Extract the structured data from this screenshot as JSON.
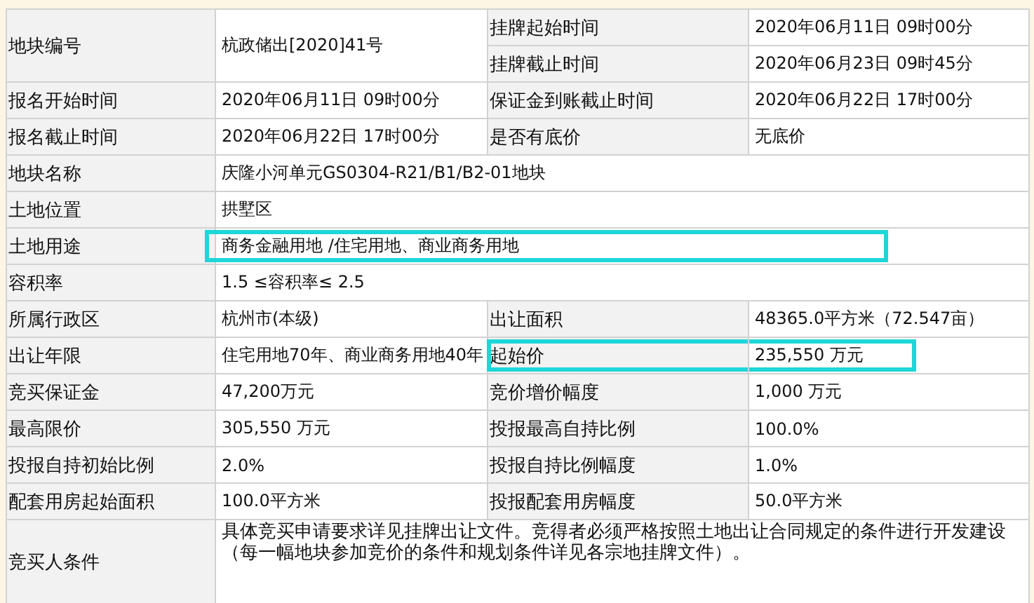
{
  "rows": [
    {
      "cells": [
        {
          "kind": "label",
          "text": "地块编号",
          "rowspan": 2
        },
        {
          "kind": "value",
          "text": "杭政储出[2020]41号",
          "rowspan": 2
        },
        {
          "kind": "label",
          "text": "挂牌起始时间"
        },
        {
          "kind": "value",
          "text": "2020年06月11日  09时00分"
        }
      ]
    },
    {
      "cells": [
        {
          "kind": "label",
          "text": "挂牌截止时间"
        },
        {
          "kind": "value",
          "text": "2020年06月23日  09时45分"
        }
      ]
    },
    {
      "cells": [
        {
          "kind": "label",
          "text": "报名开始时间"
        },
        {
          "kind": "value",
          "text": "2020年06月11日  09时00分"
        },
        {
          "kind": "label",
          "text": "保证金到账截止时间"
        },
        {
          "kind": "value",
          "text": "2020年06月22日  17时00分"
        }
      ]
    },
    {
      "cells": [
        {
          "kind": "label",
          "text": "报名截止时间"
        },
        {
          "kind": "value",
          "text": "2020年06月22日  17时00分"
        },
        {
          "kind": "label",
          "text": "是否有底价"
        },
        {
          "kind": "value",
          "text": "无底价"
        }
      ]
    },
    {
      "cells": [
        {
          "kind": "label",
          "text": "地块名称"
        },
        {
          "kind": "value",
          "text": "庆隆小河单元GS0304-R21/B1/B2-01地块",
          "colspan": 3
        }
      ]
    },
    {
      "cells": [
        {
          "kind": "label",
          "text": "土地位置"
        },
        {
          "kind": "value",
          "text": "拱墅区",
          "colspan": 3
        }
      ]
    },
    {
      "cells": [
        {
          "kind": "label",
          "text": "土地用途"
        },
        {
          "kind": "value",
          "text": "商务金融用地 /住宅用地、商业商务用地",
          "colspan": 3,
          "highlighted": true
        }
      ]
    },
    {
      "cells": [
        {
          "kind": "label",
          "text": "容积率"
        },
        {
          "kind": "value",
          "text": "1.5 ≤容积率≤ 2.5",
          "colspan": 3
        }
      ]
    },
    {
      "cells": [
        {
          "kind": "label",
          "text": "所属行政区"
        },
        {
          "kind": "value",
          "text": "杭州市(本级)"
        },
        {
          "kind": "label",
          "text": "出让面积"
        },
        {
          "kind": "value",
          "text": "48365.0平方米（72.547亩）"
        }
      ]
    },
    {
      "cells": [
        {
          "kind": "label",
          "text": "出让年限"
        },
        {
          "kind": "value",
          "text": "住宅用地70年、商业商务用地40年"
        },
        {
          "kind": "label",
          "text": "起始价",
          "highlighted": true
        },
        {
          "kind": "value",
          "text": "235,550 万元",
          "highlighted": true
        }
      ]
    },
    {
      "cells": [
        {
          "kind": "label",
          "text": "竞买保证金"
        },
        {
          "kind": "value",
          "text": "47,200万元"
        },
        {
          "kind": "label",
          "text": "竞价增价幅度"
        },
        {
          "kind": "value",
          "text": "1,000 万元"
        }
      ]
    },
    {
      "cells": [
        {
          "kind": "label",
          "text": "最高限价"
        },
        {
          "kind": "value",
          "text": "305,550 万元"
        },
        {
          "kind": "label",
          "text": "投报最高自持比例"
        },
        {
          "kind": "value",
          "text": "100.0%"
        }
      ]
    },
    {
      "cells": [
        {
          "kind": "label",
          "text": "投报自持初始比例"
        },
        {
          "kind": "value",
          "text": "2.0%"
        },
        {
          "kind": "label",
          "text": "投报自持比例幅度"
        },
        {
          "kind": "value",
          "text": "1.0%"
        }
      ]
    },
    {
      "cells": [
        {
          "kind": "label",
          "text": "配套用房起始面积"
        },
        {
          "kind": "value",
          "text": "100.0平方米"
        },
        {
          "kind": "label",
          "text": "投报配套用房幅度"
        },
        {
          "kind": "value",
          "text": "50.0平方米"
        }
      ]
    },
    {
      "cells": [
        {
          "kind": "label",
          "text": "竞买人条件"
        },
        {
          "kind": "note",
          "text": "具体竞买申请要求详见挂牌出让文件。竞得者必须严格按照土地出让合同规定的条件进行开发建设（每一幅地块参加竞价的条件和规划条件详见各宗地挂牌文件）。",
          "colspan": 3
        }
      ]
    }
  ]
}
